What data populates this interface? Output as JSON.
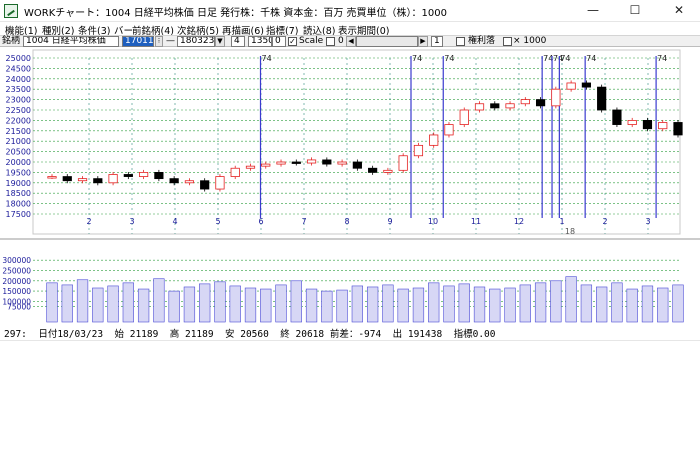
{
  "window": {
    "title": "WORKチャート：1004 日経平均株価 日足   発行株：千株  資本金：百万  売買単位（株）：1000",
    "icon": "chart-window-icon",
    "min_glyph": "—",
    "max_glyph": "☐",
    "close_glyph": "✕"
  },
  "menu": [
    "機能(1)",
    "種別(2)",
    "条件(3)",
    "バー",
    "前銘柄(4)",
    "次銘柄(5)",
    "再描画(6)",
    "指標(7)",
    "読込(8)",
    "表示期間(0)"
  ],
  "toolbar": {
    "code_label": "銘柄",
    "code_value": "1004 日経平均株価",
    "start_date": "170111",
    "dash": "—",
    "end_date": "180323",
    "span_value": "4",
    "count_value": "1350",
    "offset_value": "0",
    "scale_label": "Scale",
    "field_zero": "0",
    "page_value": "1",
    "rights_label": "権利落",
    "multiplier_label": "× 1000"
  },
  "colors": {
    "grid_h": "#2e9e3e",
    "grid_v": "#2f8a7e",
    "up_candle": "#e52121",
    "down_candle": "#000000",
    "event_line": "#3a3acf",
    "volume_bar": "#4b4bd6",
    "axis_text": "#1a1a9a",
    "toolbar_highlight": "#1e5fbf"
  },
  "chart_data": [
    {
      "type": "candlestick",
      "title": "",
      "y_ticks": [
        25000,
        24500,
        24000,
        23500,
        23000,
        22500,
        22000,
        21500,
        21000,
        20500,
        20000,
        19500,
        19000,
        18500,
        18000,
        17500
      ],
      "ylim": [
        17500,
        25000
      ],
      "x_ticks": [
        "2",
        "3",
        "4",
        "5",
        "6",
        "7",
        "8",
        "9",
        "10",
        "11",
        "12",
        "1",
        "2",
        "3"
      ],
      "year_label": "18",
      "event_label": "74",
      "event_lines": [
        5.5,
        9.0,
        9.75,
        12.05,
        12.28,
        12.45,
        13.05,
        14.7
      ],
      "close_series": [
        19300,
        19100,
        19200,
        19000,
        19400,
        19300,
        19500,
        19200,
        19000,
        19100,
        18700,
        19300,
        19700,
        19800,
        19900,
        20000,
        19950,
        20100,
        19900,
        20000,
        19700,
        19500,
        19600,
        20300,
        20800,
        21300,
        21800,
        22500,
        22800,
        22600,
        22800,
        23000,
        22700,
        23500,
        23800,
        23600,
        22500,
        21800,
        22000,
        21600,
        21900,
        21300
      ],
      "last": {
        "index": 297,
        "date": "18/03/23",
        "open": 21189,
        "high": 21189,
        "low": 20560,
        "close": 20618,
        "change": -974,
        "volume": 191438
      }
    },
    {
      "type": "bar",
      "title": "",
      "y_ticks": [
        300000,
        250000,
        200000,
        150000,
        100000,
        75000
      ],
      "ylim": [
        0,
        330000
      ],
      "values_sample": [
        190000,
        180000,
        205000,
        165000,
        175000,
        190000,
        160000,
        210000,
        150000,
        170000,
        185000,
        195000,
        175000,
        165000,
        160000,
        180000,
        200000,
        160000,
        150000,
        155000,
        175000,
        170000,
        180000,
        160000,
        165000,
        190000,
        175000,
        185000,
        170000,
        160000,
        165000,
        180000,
        190000,
        200000,
        220000,
        180000,
        170000,
        190000,
        160000,
        175000,
        165000,
        180000
      ]
    }
  ],
  "status": {
    "text": "297:  日付18/03/23  始 21189  高 21189  安 20560  終 20618 前差：-974  出 191438  指標0.00"
  }
}
